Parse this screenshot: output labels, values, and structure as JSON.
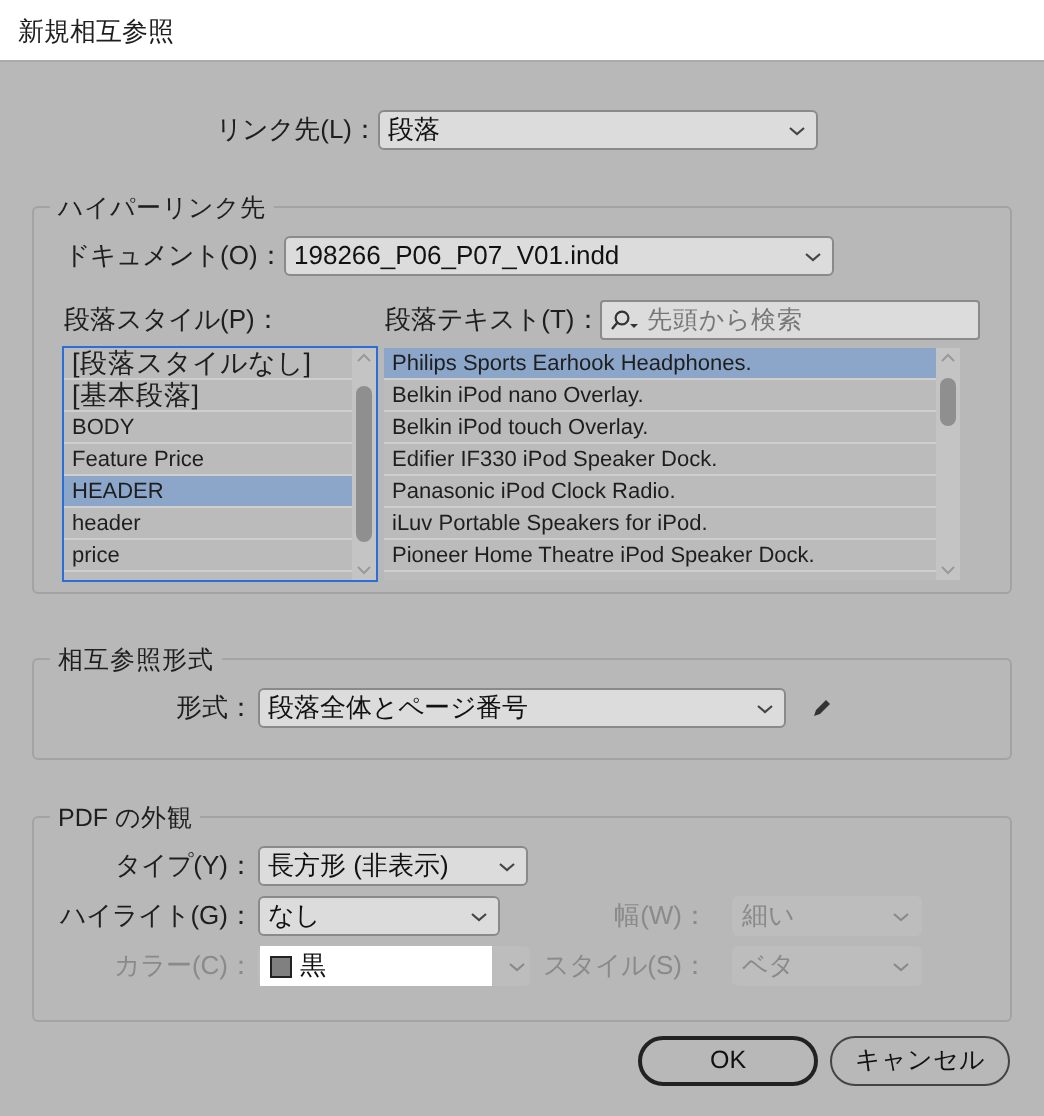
{
  "window": {
    "title": "新規相互参照"
  },
  "link_to": {
    "label": "リンク先(L)：",
    "value": "段落"
  },
  "hyperlink_destination": {
    "legend": "ハイパーリンク先",
    "document": {
      "label": "ドキュメント(O)：",
      "value": "198266_P06_P07_V01.indd"
    },
    "paragraph_styles": {
      "label": "段落スタイル(P)：",
      "items": [
        {
          "text": "[段落スタイルなし]",
          "selected": false
        },
        {
          "text": "[基本段落]",
          "selected": false
        },
        {
          "text": "BODY",
          "selected": false
        },
        {
          "text": "Feature Price",
          "selected": false
        },
        {
          "text": "HEADER",
          "selected": true
        },
        {
          "text": "header",
          "selected": false
        },
        {
          "text": "price",
          "selected": false
        }
      ]
    },
    "paragraph_text": {
      "label": "段落テキスト(T)：",
      "search": {
        "placeholder": "先頭から検索"
      },
      "items": [
        {
          "text": "Philips Sports Earhook Headphones.",
          "selected": true
        },
        {
          "text": "Belkin iPod nano Overlay.",
          "selected": false
        },
        {
          "text": "Belkin iPod touch Overlay.",
          "selected": false
        },
        {
          "text": "Edifier IF330 iPod Speaker Dock.",
          "selected": false
        },
        {
          "text": "Panasonic iPod Clock Radio.",
          "selected": false
        },
        {
          "text": "iLuv Portable Speakers for iPod.",
          "selected": false
        },
        {
          "text": "Pioneer Home Theatre iPod Speaker Dock.",
          "selected": false
        }
      ]
    }
  },
  "cross_reference_format": {
    "legend": "相互参照形式",
    "format": {
      "label": "形式：",
      "value": "段落全体とページ番号"
    }
  },
  "pdf_appearance": {
    "legend": "PDF の外観",
    "type": {
      "label": "タイプ(Y)：",
      "value": "長方形 (非表示)",
      "disabled": false
    },
    "highlight": {
      "label": "ハイライト(G)：",
      "value": "なし",
      "disabled": false
    },
    "width": {
      "label": "幅(W)：",
      "value": "細い",
      "disabled": true
    },
    "color": {
      "label": "カラー(C)：",
      "value": "黒",
      "disabled": true
    },
    "style": {
      "label": "スタイル(S)：",
      "value": "ベタ",
      "disabled": true
    }
  },
  "buttons": [
    {
      "label": "OK",
      "default": true
    },
    {
      "label": "キャンセル",
      "default": false
    }
  ]
}
